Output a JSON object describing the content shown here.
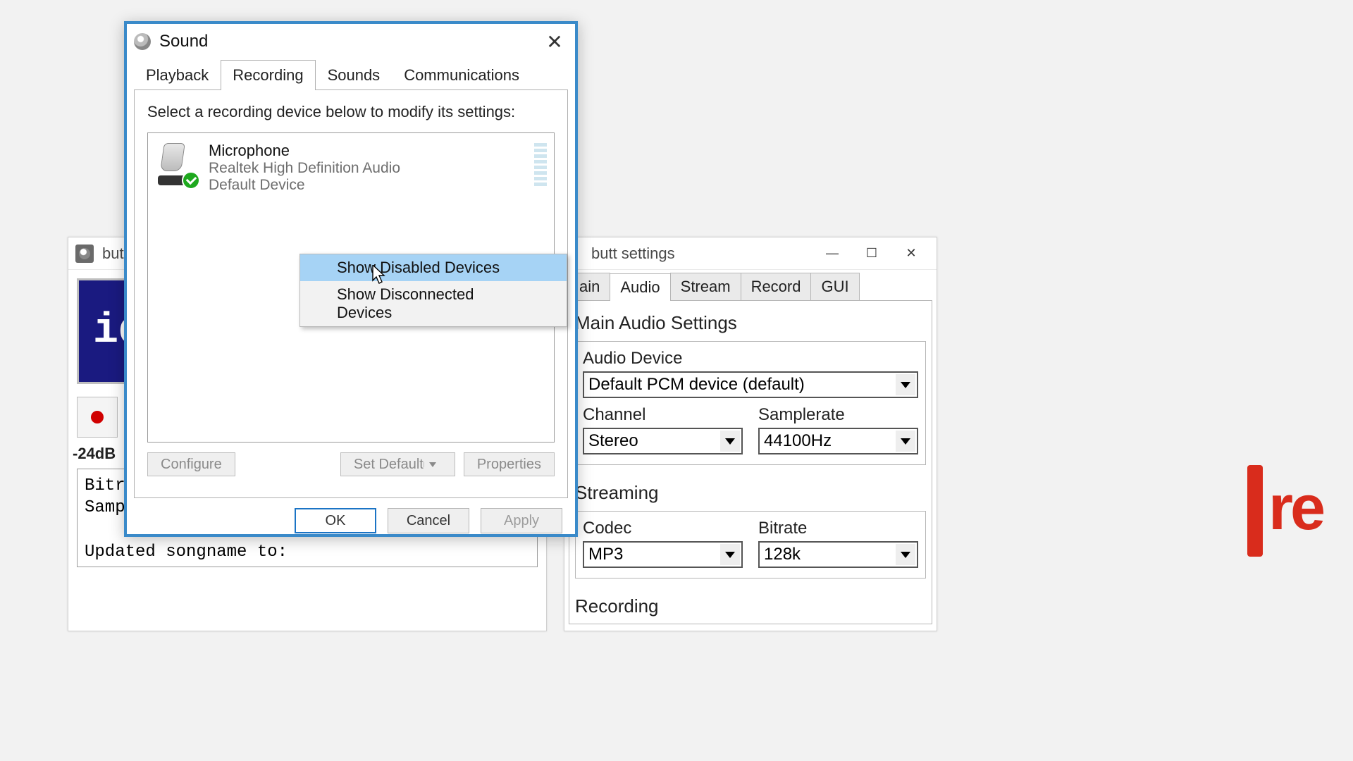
{
  "bg_logo_text": "re",
  "butt_main": {
    "title": "butt",
    "display_text": "id",
    "db_label": "-24dB",
    "log_line1": "Bitrat",
    "log_line2": "Sample",
    "log_line3": "Updated songname to:"
  },
  "butt_settings": {
    "title": "butt settings",
    "tabs": {
      "main": "ain",
      "audio": "Audio",
      "stream": "Stream",
      "record": "Record",
      "gui": "GUI"
    },
    "section_main": "Main Audio Settings",
    "audio_device_label": "Audio Device",
    "audio_device_value": "Default PCM device (default)",
    "channel_label": "Channel",
    "channel_value": "Stereo",
    "samplerate_label": "Samplerate",
    "samplerate_value": "44100Hz",
    "section_streaming": "Streaming",
    "codec_label": "Codec",
    "codec_value": "MP3",
    "bitrate_label": "Bitrate",
    "bitrate_value": "128k",
    "section_recording": "Recording"
  },
  "sound": {
    "title": "Sound",
    "tabs": {
      "playback": "Playback",
      "recording": "Recording",
      "sounds": "Sounds",
      "communications": "Communications"
    },
    "instruction": "Select a recording device below to modify its settings:",
    "device": {
      "name": "Microphone",
      "desc": "Realtek High Definition Audio",
      "status": "Default Device"
    },
    "buttons": {
      "configure": "Configure",
      "set_default": "Set Default",
      "properties": "Properties",
      "ok": "OK",
      "cancel": "Cancel",
      "apply": "Apply"
    },
    "context_menu": {
      "show_disabled": "Show Disabled Devices",
      "show_disconnected": "Show Disconnected Devices"
    }
  }
}
